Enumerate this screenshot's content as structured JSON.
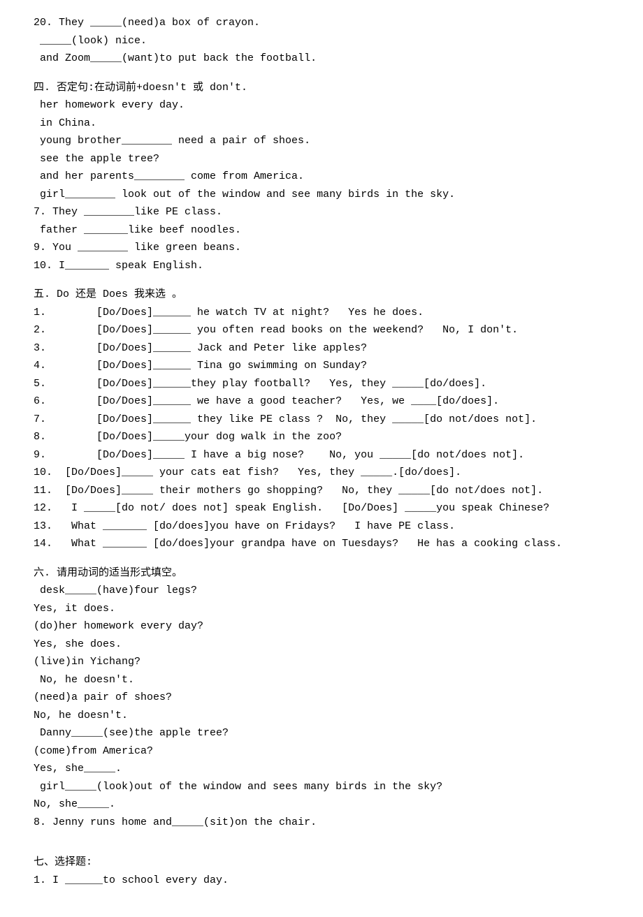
{
  "top": {
    "l1": "20. They _____(need)a box of crayon.",
    "l2": " _____(look) nice.",
    "l3": " and Zoom_____(want)to put back the football."
  },
  "s4": {
    "title": "四. 否定句:在动词前+doesn't 或 don't.",
    "l1": " her homework every day.",
    "l2": " in China.",
    "l3": " young brother________ need a pair of shoes.",
    "l4": " see the apple tree?",
    "l5": " and her parents________ come from America.",
    "l6": " girl________ look out of the window and see many birds in the sky.",
    "l7": "7. They ________like PE class.",
    "l8": " father _______like beef noodles.",
    "l9": "9. You ________ like green beans.",
    "l10": "10. I_______ speak English."
  },
  "s5": {
    "title": "五. Do 还是 Does 我来选 。",
    "q1": "1.        [Do/Does]______ he watch TV at night?   Yes he does.",
    "q2": "2.        [Do/Does]______ you often read books on the weekend?   No, I don't.",
    "q3": "3.        [Do/Does]______ Jack and Peter like apples?",
    "q4": "4.        [Do/Does]______ Tina go swimming on Sunday?",
    "q5": "5.        [Do/Does]______they play football?   Yes, they _____[do/does].",
    "q6": "6.        [Do/Does]______ we have a good teacher?   Yes, we ____[do/does].",
    "q7": "7.        [Do/Does]______ they like PE class ?  No, they _____[do not/does not].",
    "q8": "8.        [Do/Does]_____your dog walk in the zoo?",
    "q9": "9.        [Do/Does]_____ I have a big nose?    No, you _____[do not/does not].",
    "q10": "10.  [Do/Does]_____ your cats eat fish?   Yes, they _____.[do/does].",
    "q11": "11.  [Do/Does]_____ their mothers go shopping?   No, they _____[do not/does not].",
    "q12": "12.   I _____[do not/ does not] speak English.   [Do/Does] _____you speak Chinese?",
    "q13": "13.   What _______ [do/does]you have on Fridays?   I have PE class.",
    "q14": "14.   What _______ [do/does]your grandpa have on Tuesdays?   He has a cooking class."
  },
  "s6": {
    "title": "六. 请用动词的适当形式填空。",
    "l1": " desk_____(have)four legs?",
    "l2": "Yes, it does.",
    "l3": "(do)her homework every day?",
    "l4": "Yes, she does.",
    "l5": "(live)in Yichang?",
    "l6": " No, he doesn't.",
    "l7": "(need)a pair of shoes?",
    "l8": "No, he doesn't.",
    "l9": " Danny_____(see)the apple tree?",
    "l10": "(come)from America?",
    "l11": "Yes, she_____.",
    "l12": " girl_____(look)out of the window and sees many birds in the sky?",
    "l13": "No, she_____.",
    "l14": "8. Jenny runs home and_____(sit)on the chair."
  },
  "s7": {
    "title": "七、选择题:",
    "q1": "1. I ______to school every day."
  }
}
